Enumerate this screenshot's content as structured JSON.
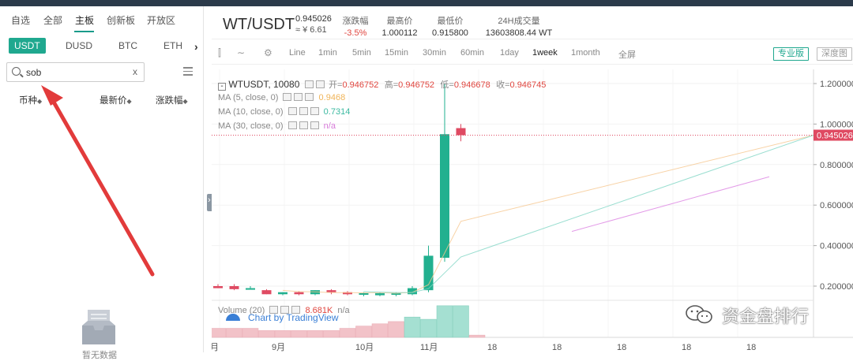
{
  "left_panel": {
    "tabs": [
      "自选",
      "全部",
      "主板",
      "创新板",
      "开放区"
    ],
    "active_tab": "主板",
    "quote_tabs": [
      "USDT",
      "DUSD",
      "BTC",
      "ETH"
    ],
    "active_quote": "USDT",
    "search_value": "sob",
    "clear_label": "x",
    "columns": [
      "币种",
      "最新价",
      "涨跌幅"
    ],
    "empty_label": "暂无数据"
  },
  "header": {
    "pair": "WT/USDT",
    "price": "0.945026",
    "price_cny": "≈ ¥ 6.61",
    "change_label": "涨跌幅",
    "change_value": "-3.5%",
    "high_label": "最高价",
    "high_value": "1.000112",
    "low_label": "最低价",
    "low_value": "0.915800",
    "volume_label": "24H成交量",
    "volume_value": "13603808.44 WT"
  },
  "toolbar": {
    "intervals": [
      "Line",
      "1min",
      "5min",
      "15min",
      "30min",
      "60min",
      "1day",
      "1week",
      "1month"
    ],
    "active_interval": "1week",
    "fullscreen": "全屏",
    "pro_button": "专业版",
    "depth_button": "深度图"
  },
  "chart_legend": {
    "symbol": "WTUSDT, 10080",
    "open_label": "开=",
    "open": "0.946752",
    "high_label": "高=",
    "high": "0.946752",
    "low_label": "低=",
    "low": "0.946678",
    "close_label": "收=",
    "close": "0.946745",
    "ma5_label": "MA (5, close, 0)",
    "ma5_value": "0.9468",
    "ma10_label": "MA (10, close, 0)",
    "ma10_value": "0.7314",
    "ma30_label": "MA (30, close, 0)",
    "ma30_value": "n/a",
    "volume_label": "Volume (20)",
    "volume_value": "8.681K",
    "volume_value2": "n/a",
    "tradingview": "Chart by TradingView"
  },
  "chart_data": {
    "type": "candlestick",
    "y_ticks": [
      "1.200000",
      "1.000000",
      "0.800000",
      "0.600000",
      "0.400000",
      "0.200000"
    ],
    "y_tick_values": [
      1.2,
      1.0,
      0.8,
      0.6,
      0.4,
      0.2
    ],
    "ylim": [
      0.13,
      1.27
    ],
    "last_price_label": "0.945026",
    "last_price": 0.945026,
    "x_ticks": [
      "月",
      "9月",
      "10月",
      "11月",
      "18",
      "18",
      "18",
      "18",
      "18"
    ],
    "candles": [
      {
        "o": 0.2,
        "h": 0.21,
        "l": 0.19,
        "c": 0.19
      },
      {
        "o": 0.2,
        "h": 0.21,
        "l": 0.18,
        "c": 0.185
      },
      {
        "o": 0.19,
        "h": 0.2,
        "l": 0.185,
        "c": 0.19
      },
      {
        "o": 0.18,
        "h": 0.185,
        "l": 0.16,
        "c": 0.16
      },
      {
        "o": 0.16,
        "h": 0.17,
        "l": 0.155,
        "c": 0.17
      },
      {
        "o": 0.17,
        "h": 0.175,
        "l": 0.155,
        "c": 0.16
      },
      {
        "o": 0.16,
        "h": 0.18,
        "l": 0.155,
        "c": 0.18
      },
      {
        "o": 0.18,
        "h": 0.185,
        "l": 0.16,
        "c": 0.17
      },
      {
        "o": 0.17,
        "h": 0.175,
        "l": 0.155,
        "c": 0.16
      },
      {
        "o": 0.16,
        "h": 0.17,
        "l": 0.15,
        "c": 0.165
      },
      {
        "o": 0.155,
        "h": 0.17,
        "l": 0.15,
        "c": 0.165
      },
      {
        "o": 0.16,
        "h": 0.17,
        "l": 0.15,
        "c": 0.165
      },
      {
        "o": 0.16,
        "h": 0.2,
        "l": 0.155,
        "c": 0.19
      },
      {
        "o": 0.18,
        "h": 0.4,
        "l": 0.17,
        "c": 0.35
      },
      {
        "o": 0.34,
        "h": 1.2,
        "l": 0.32,
        "c": 0.95
      },
      {
        "o": 0.98,
        "h": 1.0,
        "l": 0.915,
        "c": 0.945
      }
    ],
    "volumes": [
      2,
      2,
      2,
      1.5,
      1.5,
      1.5,
      1.5,
      1.5,
      2,
      2.5,
      3,
      3.5,
      4.5,
      4,
      7,
      7,
      0.5
    ],
    "volume_colors": [
      "red",
      "red",
      "red",
      "red",
      "red",
      "red",
      "red",
      "red",
      "red",
      "red",
      "red",
      "red",
      "green",
      "green",
      "green",
      "green",
      "red"
    ]
  },
  "watermark": "资金盘排行"
}
